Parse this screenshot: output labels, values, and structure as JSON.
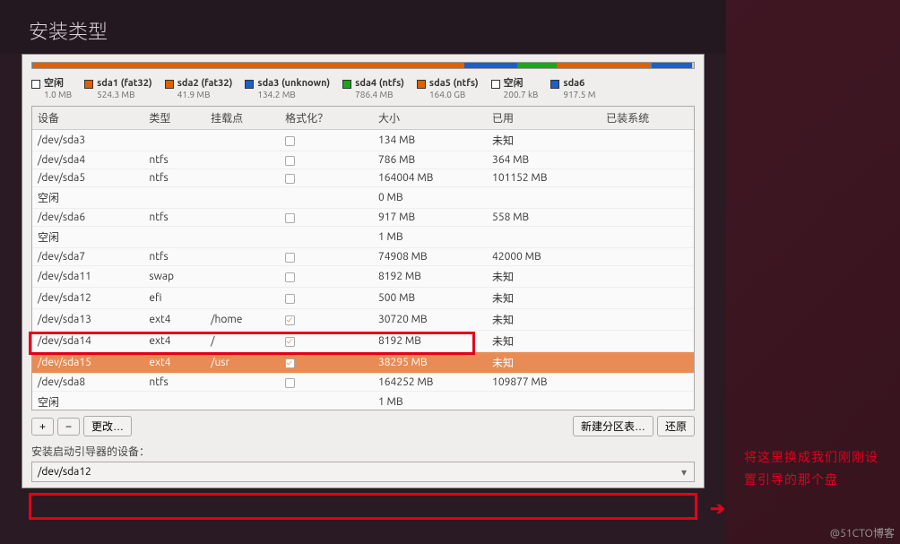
{
  "title": "安装类型",
  "usage_bar": [
    {
      "color": "#7a7a7a",
      "width": "0.3%"
    },
    {
      "color": "#e06000",
      "width": "55%"
    },
    {
      "color": "#e06000",
      "width": "10%"
    },
    {
      "color": "#1a60c8",
      "width": "8%"
    },
    {
      "color": "#18a818",
      "width": "6%"
    },
    {
      "color": "#e06000",
      "width": "14%"
    },
    {
      "color": "#7a7a7a",
      "width": "0.4%"
    },
    {
      "color": "#1a60c8",
      "width": "6%"
    }
  ],
  "legend": [
    {
      "color": "#ffffff",
      "name": "空闲",
      "size": "1.0 MB"
    },
    {
      "color": "#e06000",
      "name": "sda1 (fat32)",
      "size": "524.3 MB"
    },
    {
      "color": "#e06000",
      "name": "sda2 (fat32)",
      "size": "41.9 MB"
    },
    {
      "color": "#1a60c8",
      "name": "sda3 (unknown)",
      "size": "134.2 MB"
    },
    {
      "color": "#18a818",
      "name": "sda4 (ntfs)",
      "size": "786.4 MB"
    },
    {
      "color": "#e06000",
      "name": "sda5 (ntfs)",
      "size": "164.0 GB"
    },
    {
      "color": "#ffffff",
      "name": "空闲",
      "size": "200.7 kB"
    },
    {
      "color": "#1a60c8",
      "name": "sda6",
      "size": "917.5 M"
    }
  ],
  "columns": [
    "设备",
    "类型",
    "挂载点",
    "格式化？",
    "大小",
    "已用",
    "已装系统"
  ],
  "rows": [
    {
      "dev": "/dev/sda3",
      "type": "",
      "mount": "",
      "fmt": false,
      "size": "134 MB",
      "used": "未知",
      "sys": ""
    },
    {
      "dev": "/dev/sda4",
      "type": "ntfs",
      "mount": "",
      "fmt": false,
      "size": "786 MB",
      "used": "364 MB",
      "sys": ""
    },
    {
      "dev": "/dev/sda5",
      "type": "ntfs",
      "mount": "",
      "fmt": false,
      "size": "164004 MB",
      "used": "101152 MB",
      "sys": ""
    },
    {
      "dev": "空闲",
      "type": "",
      "mount": "",
      "fmt": null,
      "size": "0 MB",
      "used": "",
      "sys": ""
    },
    {
      "dev": "/dev/sda6",
      "type": "ntfs",
      "mount": "",
      "fmt": false,
      "size": "917 MB",
      "used": "558 MB",
      "sys": ""
    },
    {
      "dev": "空闲",
      "type": "",
      "mount": "",
      "fmt": null,
      "size": "1 MB",
      "used": "",
      "sys": ""
    },
    {
      "dev": "/dev/sda7",
      "type": "ntfs",
      "mount": "",
      "fmt": false,
      "size": "74908 MB",
      "used": "42000 MB",
      "sys": ""
    },
    {
      "dev": "/dev/sda11",
      "type": "swap",
      "mount": "",
      "fmt": false,
      "size": "8192 MB",
      "used": "未知",
      "sys": ""
    },
    {
      "dev": "/dev/sda12",
      "type": "efi",
      "mount": "",
      "fmt": false,
      "size": "500 MB",
      "used": "未知",
      "sys": ""
    },
    {
      "dev": "/dev/sda13",
      "type": "ext4",
      "mount": "/home",
      "fmt": true,
      "size": "30720 MB",
      "used": "未知",
      "sys": ""
    },
    {
      "dev": "/dev/sda14",
      "type": "ext4",
      "mount": "/",
      "fmt": true,
      "size": "8192 MB",
      "used": "未知",
      "sys": ""
    },
    {
      "dev": "/dev/sda15",
      "type": "ext4",
      "mount": "/usr",
      "fmt": true,
      "size": "38295 MB",
      "used": "未知",
      "sys": "",
      "selected": true
    },
    {
      "dev": "/dev/sda8",
      "type": "ntfs",
      "mount": "",
      "fmt": false,
      "size": "164252 MB",
      "used": "109877 MB",
      "sys": ""
    },
    {
      "dev": "空闲",
      "type": "",
      "mount": "",
      "fmt": null,
      "size": "1 MB",
      "used": "",
      "sys": ""
    }
  ],
  "buttons": {
    "add": "+",
    "remove": "−",
    "change": "更改…",
    "newtable": "新建分区表…",
    "revert": "还原"
  },
  "boot_label": "安装启动引导器的设备：",
  "boot_value": "/dev/sda12",
  "annotation": "将这里换成我们刚刚设置引导的那个盘",
  "watermark": "@51CTO博客"
}
